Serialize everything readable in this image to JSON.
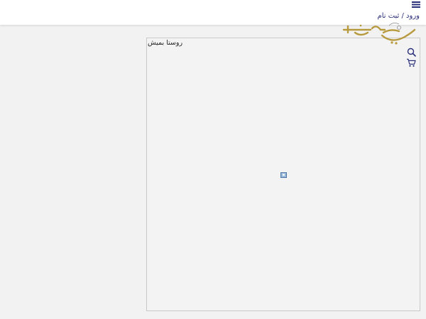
{
  "header": {
    "menu_icon": "hamburger-menu-icon",
    "login_register_label": "ورود / ثبت نام",
    "search_icon": "search-icon",
    "cart_icon": "shopping-cart-icon",
    "brand_color": "#b89a3e",
    "link_color": "#2a2f7a"
  },
  "content": {
    "frame_title": "روستا بمیش",
    "image_icon": "broken-image-icon"
  }
}
